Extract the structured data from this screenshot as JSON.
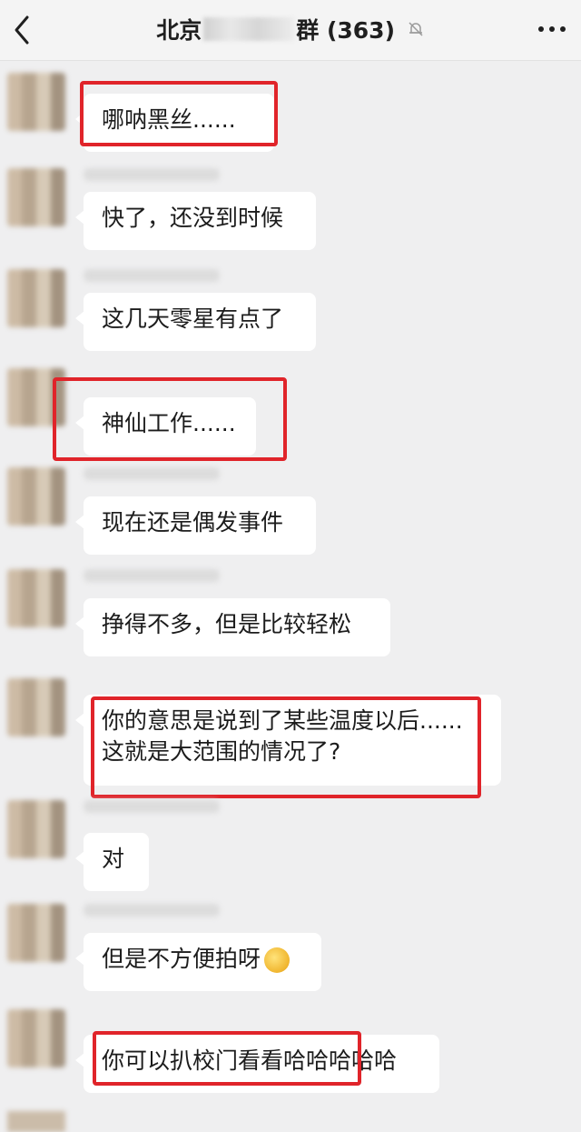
{
  "header": {
    "title_prefix": "北京",
    "title_suffix": "群 (363)"
  },
  "messages": [
    {
      "text": "哪呐黑丝......"
    },
    {
      "text": "快了，还没到时候"
    },
    {
      "text": "这几天零星有点了"
    },
    {
      "text": "神仙工作......"
    },
    {
      "text": "现在还是偶发事件"
    },
    {
      "text": "挣得不多，但是比较轻松"
    },
    {
      "line1": "你的意思是说到了某些温度以后......",
      "line2": "这就是大范围的情况了?"
    },
    {
      "text": "对"
    },
    {
      "text": "但是不方便拍呀"
    },
    {
      "text": "你可以扒校门看看哈哈哈哈哈"
    }
  ],
  "colors": {
    "highlight_border": "#e0242a",
    "bubble_bg": "#ffffff",
    "page_bg": "#efeff0"
  },
  "icons": [
    "back-arrow-icon",
    "mute-bell-icon",
    "more-icon",
    "grimace-emoji-icon"
  ]
}
